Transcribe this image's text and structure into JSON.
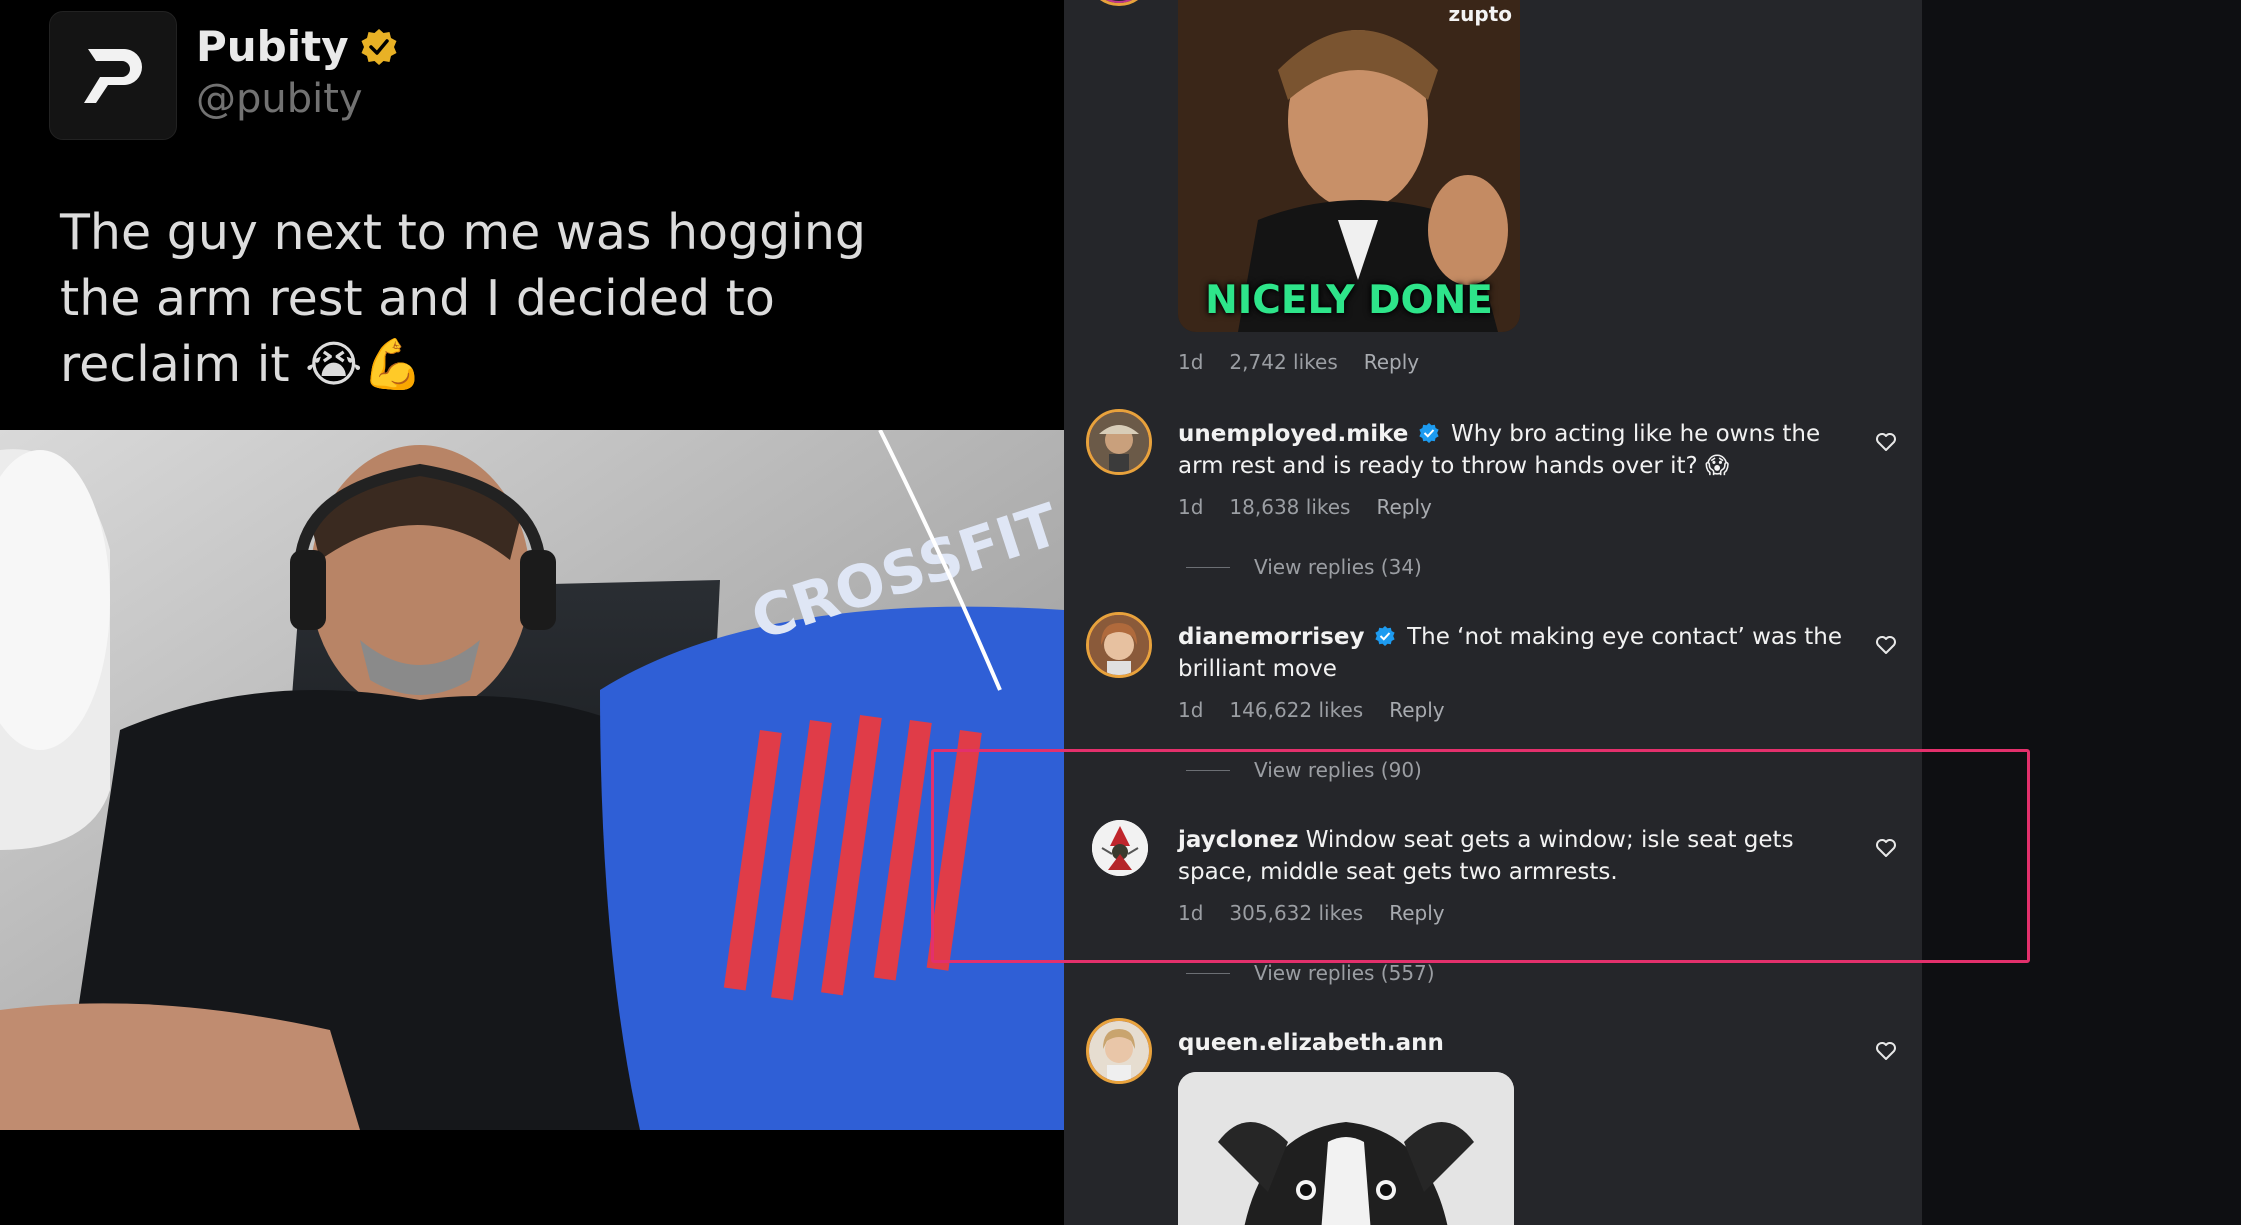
{
  "post": {
    "tweet": {
      "display_name": "Pubity",
      "handle": "@pubity",
      "text": "The guy next to me was hogging the arm rest and I decided to reclaim it 😭💪"
    },
    "video": {
      "shirt_text": "CROSSFIT GAME"
    }
  },
  "comments": {
    "top_gif_comment": {
      "gif_brand": "zupto",
      "gif_caption": "NICELY DONE",
      "time": "1d",
      "likes": "2,742 likes",
      "reply_label": "Reply"
    },
    "items": [
      {
        "username": "unemployed.mike",
        "verified": true,
        "text": "Why bro acting like he owns the arm rest and is ready to throw hands over it? 😱",
        "time": "1d",
        "likes": "18,638 likes",
        "reply_label": "Reply",
        "view_replies": "View replies (34)"
      },
      {
        "username": "dianemorrisey",
        "verified": true,
        "text": "The ‘not making eye contact’ was the brilliant move",
        "time": "1d",
        "likes": "146,622 likes",
        "reply_label": "Reply",
        "view_replies": "View replies (90)"
      },
      {
        "username": "jayclonez",
        "verified": false,
        "text": "Window seat gets a window; isle seat gets space, middle seat gets two armrests.",
        "time": "1d",
        "likes": "305,632 likes",
        "reply_label": "Reply",
        "view_replies": "View replies (557)"
      },
      {
        "username": "queen.elizabeth.ann",
        "verified": false,
        "text": ""
      }
    ]
  },
  "colors": {
    "panel_bg": "#25262a",
    "highlight": "#e3306c",
    "verified": "#1d9bf0",
    "gold_badge": "#e8b125",
    "gif_caption": "#2ee58a"
  }
}
